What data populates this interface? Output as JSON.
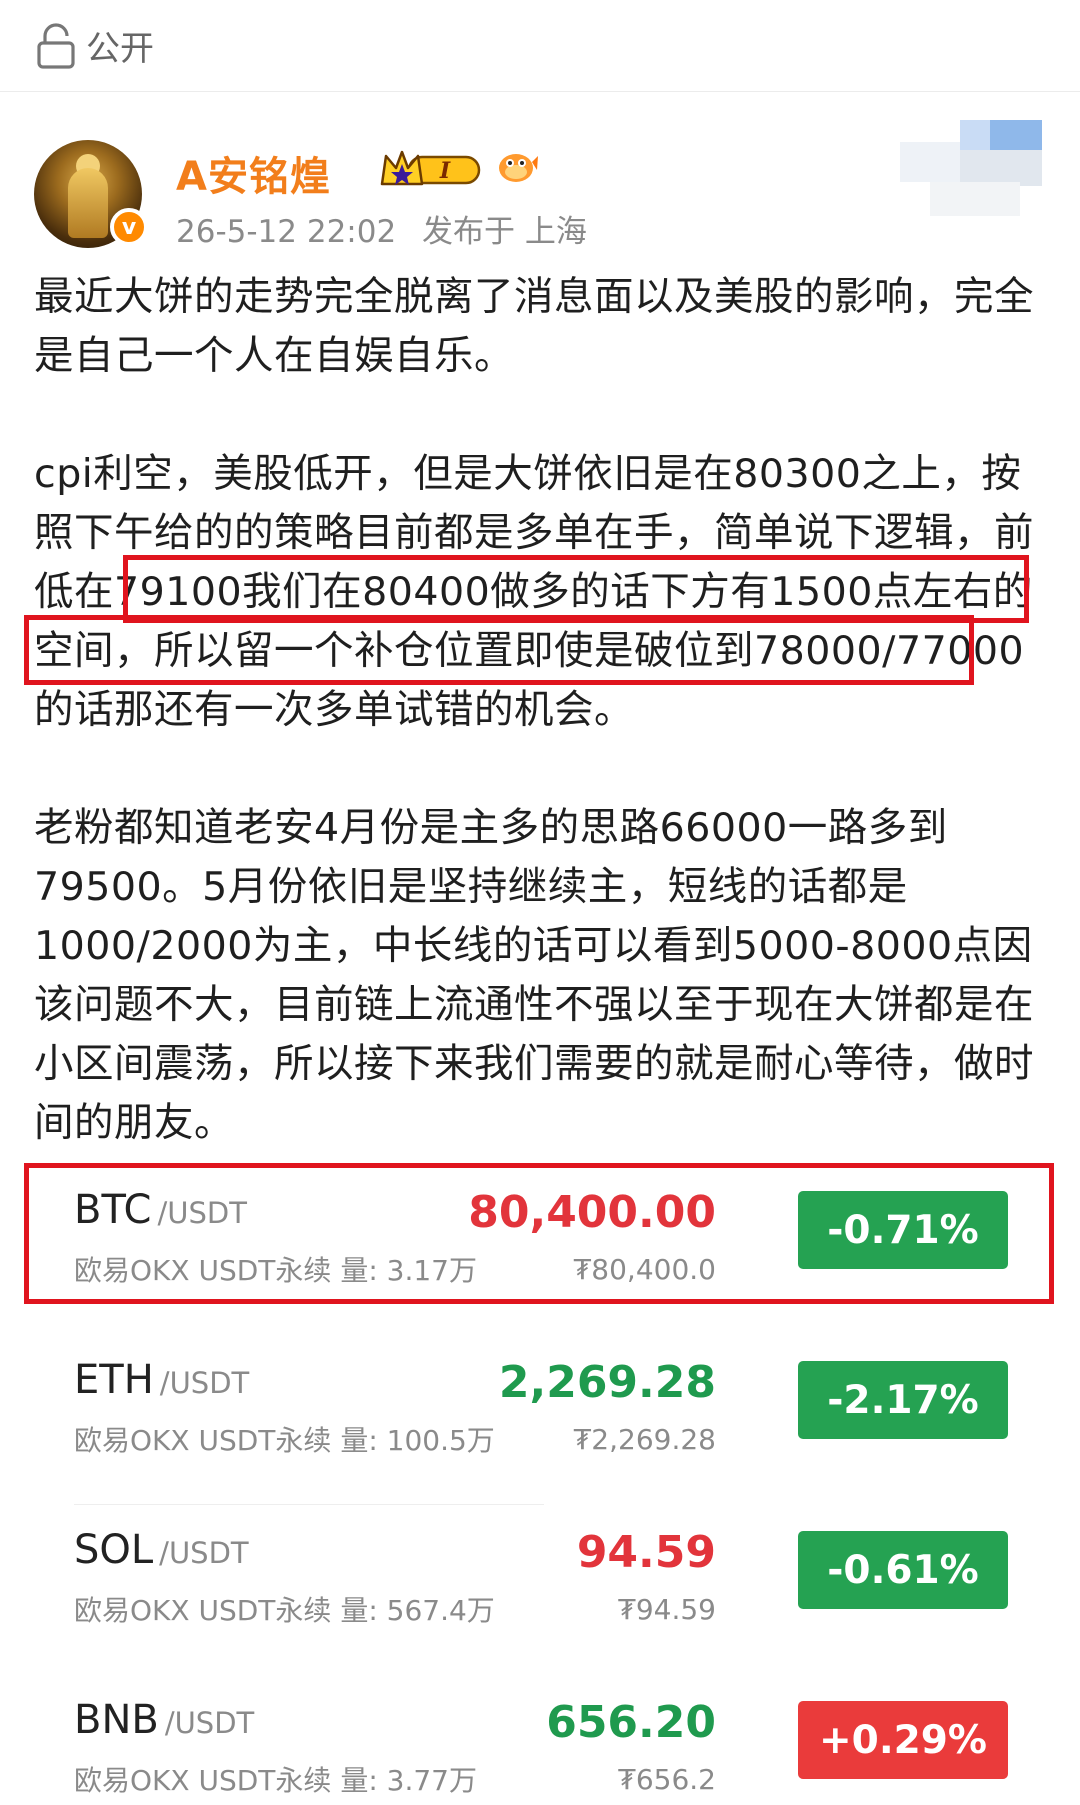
{
  "topbar": {
    "visibility_label": "公开"
  },
  "author": {
    "name": "A安铭煌",
    "vip_level": "I",
    "verified": "v",
    "date": "26-5-12 22:02",
    "location": "发布于 上海"
  },
  "post": {
    "paragraphs": [
      "最近大饼的走势完全脱离了消息面以及美股的影响，完全是自己一个人在自娱自乐。",
      "cpi利空，美股低开，但是大饼依旧是在80300之上，按照下午给的的策略目前都是多单在手，简单说下逻辑，前低在79100我们在80400做多的话下方有1500点左右的空间，所以留一个补仓位置即使是破位到78000/77000的话那还有一次多单试错的机会。",
      "老粉都知道老安4月份是主多的思路66000一路多到79500。5月份依旧是坚持继续主，短线的话都是1000/2000为主，中长线的话可以看到5000-8000点因该问题不大，目前链上流通性不强以至于现在大饼都是在小区间震荡，所以接下来我们需要的就是耐心等待，做时间的朋友。"
    ]
  },
  "tickers": [
    {
      "symbol": "BTC",
      "pair": "/USDT",
      "source": "欧易OKX USDT永续  量: 3.17万",
      "price": "80,400.00",
      "fiat": "₮80,400.0",
      "change": "-0.71%",
      "price_color": "red",
      "change_color": "green"
    },
    {
      "symbol": "ETH",
      "pair": "/USDT",
      "source": "欧易OKX USDT永续  量: 100.5万",
      "price": "2,269.28",
      "fiat": "₮2,269.28",
      "change": "-2.17%",
      "price_color": "green",
      "change_color": "green"
    },
    {
      "symbol": "SOL",
      "pair": "/USDT",
      "source": "欧易OKX USDT永续  量: 567.4万",
      "price": "94.59",
      "fiat": "₮94.59",
      "change": "-0.61%",
      "price_color": "red",
      "change_color": "green"
    },
    {
      "symbol": "BNB",
      "pair": "/USDT",
      "source": "欧易OKX USDT永续  量: 3.77万",
      "price": "656.20",
      "fiat": "₮656.2",
      "change": "+0.29%",
      "price_color": "green",
      "change_color": "red"
    }
  ],
  "colors": {
    "username": "#f27e1b",
    "highlight_border": "#e0141e",
    "up_green": "#25a252",
    "down_red": "#ea3b3b"
  }
}
